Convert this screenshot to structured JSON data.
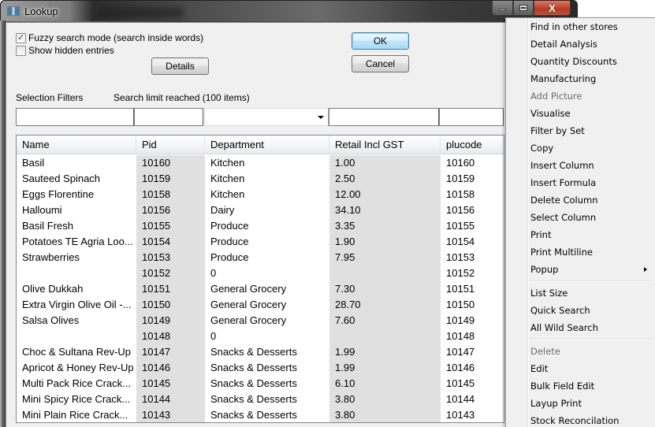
{
  "window": {
    "title": "Lookup",
    "blurred_background_title": "Account No",
    "minimize_label": "",
    "maximize_label": "",
    "close_label": "X"
  },
  "options": {
    "fuzzy_search": {
      "label": "Fuzzy search mode (search inside words)",
      "checked": true,
      "mark": "✓"
    },
    "show_hidden": {
      "label": "Show hidden entries",
      "checked": false,
      "mark": ""
    }
  },
  "buttons": {
    "details": "Details",
    "ok": "OK",
    "cancel": "Cancel"
  },
  "filters": {
    "label": "Selection Filters",
    "status": "Search limit reached (100 items)",
    "values": [
      "",
      "",
      "",
      "",
      ""
    ]
  },
  "grid": {
    "columns": [
      "Name",
      "Pid",
      "Department",
      "Retail Incl GST",
      "plucode"
    ],
    "rows": [
      [
        "Basil",
        "10160",
        "Kitchen",
        "1.00",
        "10160"
      ],
      [
        "Sauteed Spinach",
        "10159",
        "Kitchen",
        "2.50",
        "10159"
      ],
      [
        "Eggs Florentine",
        "10158",
        "Kitchen",
        "12.00",
        "10158"
      ],
      [
        "Halloumi",
        "10156",
        "Dairy",
        "34.10",
        "10156"
      ],
      [
        "Basil Fresh",
        "10155",
        "Produce",
        "3.35",
        "10155"
      ],
      [
        "Potatoes TE Agria Loo...",
        "10154",
        "Produce",
        "1.90",
        "10154"
      ],
      [
        "Strawberries",
        "10153",
        "Produce",
        "7.95",
        "10153"
      ],
      [
        "",
        "10152",
        "0",
        "",
        "10152"
      ],
      [
        "Olive Dukkah",
        "10151",
        "General Grocery",
        "7.30",
        "10151"
      ],
      [
        "Extra Virgin Olive Oil -...",
        "10150",
        "General Grocery",
        "28.70",
        "10150"
      ],
      [
        "Salsa Olives",
        "10149",
        "General Grocery",
        "7.60",
        "10149"
      ],
      [
        "",
        "10148",
        "0",
        "",
        "10148"
      ],
      [
        "Choc & Sultana Rev-Up",
        "10147",
        "Snacks & Desserts",
        "1.99",
        "10147"
      ],
      [
        "Apricot & Honey Rev-Up",
        "10146",
        "Snacks & Desserts",
        "1.99",
        "10146"
      ],
      [
        "Multi Pack Rice Crack...",
        "10145",
        "Snacks & Desserts",
        "6.10",
        "10145"
      ],
      [
        "Mini Spicy Rice Crack...",
        "10144",
        "Snacks & Desserts",
        "3.80",
        "10144"
      ],
      [
        "Mini Plain Rice Crack...",
        "10143",
        "Snacks & Desserts",
        "3.80",
        "10143"
      ]
    ]
  },
  "context_menu": {
    "groups": [
      [
        {
          "label": "Find in other stores",
          "enabled": true
        },
        {
          "label": "Detail Analysis",
          "enabled": true
        },
        {
          "label": "Quantity Discounts",
          "enabled": true
        },
        {
          "label": "Manufacturing",
          "enabled": true
        },
        {
          "label": "Add Picture",
          "enabled": false
        },
        {
          "label": "Visualise",
          "enabled": true
        },
        {
          "label": "Filter by Set",
          "enabled": true
        },
        {
          "label": "Copy",
          "enabled": true
        },
        {
          "label": "Insert Column",
          "enabled": true
        },
        {
          "label": "Insert Formula",
          "enabled": true
        },
        {
          "label": "Delete Column",
          "enabled": true
        },
        {
          "label": "Select Column",
          "enabled": true
        },
        {
          "label": "Print",
          "enabled": true
        },
        {
          "label": "Print Multiline",
          "enabled": true
        },
        {
          "label": "Popup",
          "enabled": true,
          "submenu": true
        }
      ],
      [
        {
          "label": "List Size",
          "enabled": true
        },
        {
          "label": "Quick Search",
          "enabled": true
        },
        {
          "label": "All Wild Search",
          "enabled": true
        }
      ],
      [
        {
          "label": "Delete",
          "enabled": false
        },
        {
          "label": "Edit",
          "enabled": true
        },
        {
          "label": "Bulk Field Edit",
          "enabled": true
        },
        {
          "label": "Layup Print",
          "enabled": true
        },
        {
          "label": "Stock Reconcilation",
          "enabled": true
        }
      ]
    ]
  }
}
